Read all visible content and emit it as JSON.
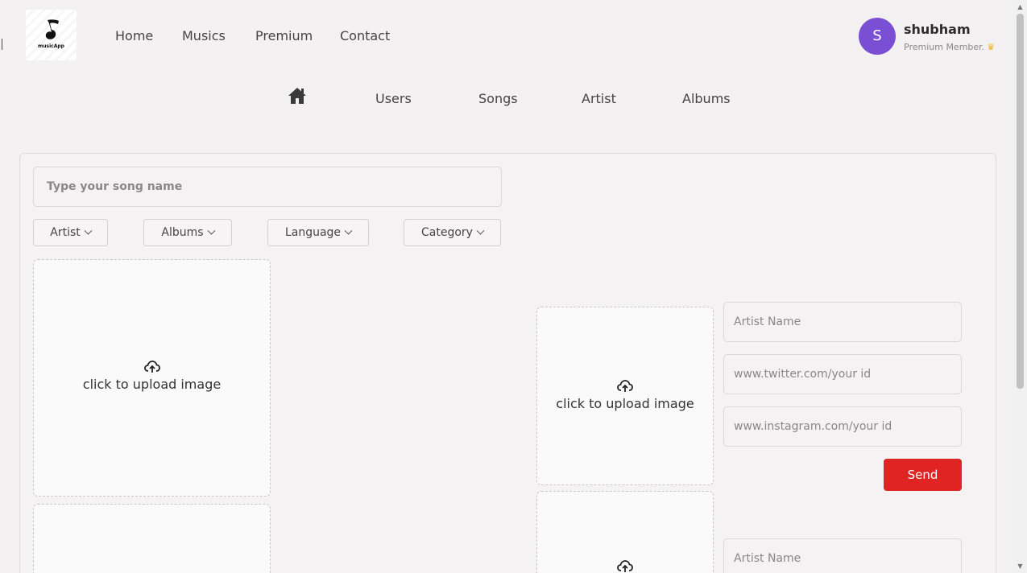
{
  "header": {
    "logo_text": "musicApp",
    "nav": [
      "Home",
      "Musics",
      "Premium",
      "Contact"
    ],
    "user": {
      "avatar_letter": "S",
      "name": "shubham",
      "role": "Premium Member.",
      "avatar_color": "#7b4fd3"
    }
  },
  "subnav": {
    "home_icon": "home-icon",
    "links": [
      "Users",
      "Songs",
      "Artist",
      "Albums"
    ]
  },
  "form": {
    "song_placeholder": "Type your song name",
    "dropdowns": [
      "Artist",
      "Albums",
      "Language",
      "Category"
    ],
    "upload_text": "click to upload image",
    "artist_name_placeholder": "Artist Name",
    "twitter_placeholder": "www.twitter.com/your id",
    "instagram_placeholder": "www.instagram.com/your id",
    "send_label": "Send",
    "send_color": "#e02424"
  }
}
